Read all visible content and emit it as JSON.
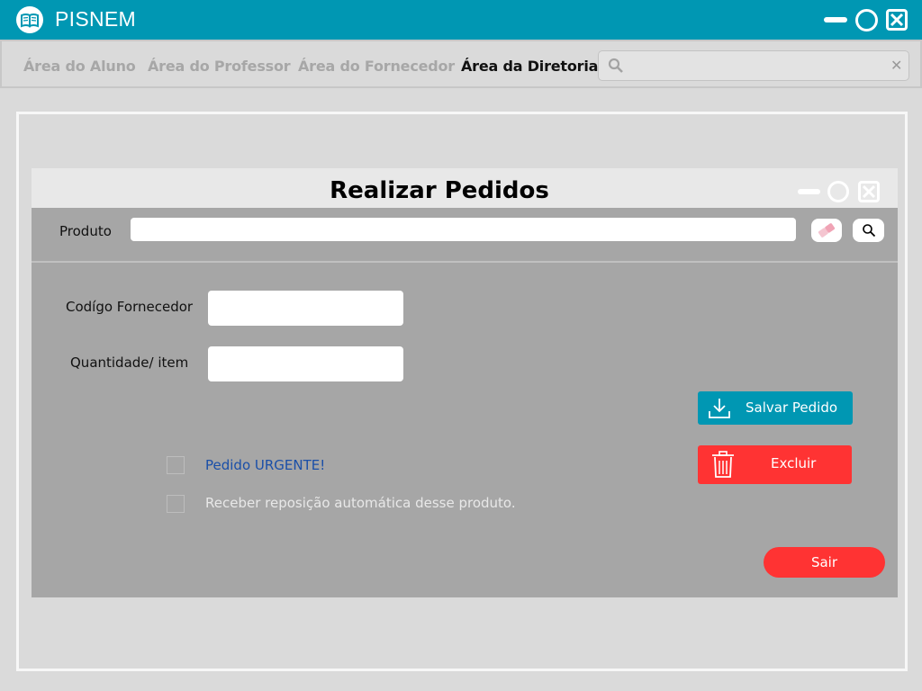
{
  "app": {
    "title": "PISNEM"
  },
  "nav": {
    "tabs": [
      {
        "label": "Área do Aluno"
      },
      {
        "label": "Área do Professor"
      },
      {
        "label": "Área do Fornecedor"
      },
      {
        "label": "Área da Diretoria"
      }
    ],
    "active_tab": "Área da Diretoria",
    "search": {
      "value": "",
      "placeholder": ""
    }
  },
  "dialog": {
    "title": "Realizar Pedidos",
    "product_label": "Produto",
    "product_value": "",
    "supplier_code_label": "Codígo Fornecedor",
    "supplier_code_value": "",
    "quantity_label": "Quantidade/ item",
    "quantity_value": "",
    "save_label": "Salvar Pedido",
    "delete_label": "Excluir",
    "exit_label": "Sair",
    "urgent_label": "Pedido URGENTE!",
    "auto_restock_label": "Receber reposição automática  desse produto."
  },
  "colors": {
    "primary": "#0097b3",
    "danger": "#ff3333",
    "urgent_text": "#1a4fa8",
    "muted_text": "#e8e8e8"
  },
  "icons": {
    "app": "book-icon",
    "search": "magnifier-icon",
    "eraser": "eraser-icon",
    "save": "download-icon",
    "delete": "trash-icon"
  }
}
